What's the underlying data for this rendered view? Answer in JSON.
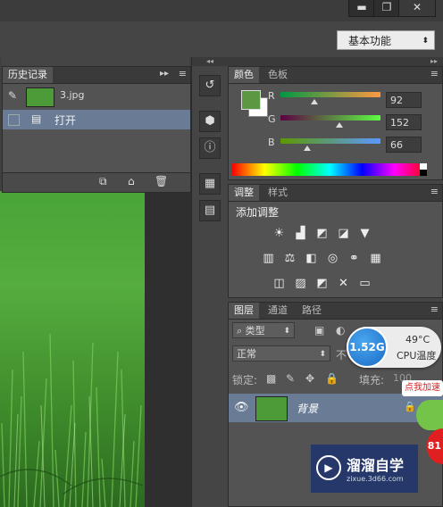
{
  "window": {
    "minimize": "▬",
    "restore": "❐",
    "close": "✕"
  },
  "workspace": {
    "label": "基本功能",
    "arrow": "⬍"
  },
  "history": {
    "tab": "历史记录",
    "snapshot": {
      "name": "3.jpg"
    },
    "items": [
      {
        "label": "打开"
      }
    ]
  },
  "color": {
    "tabs": [
      "颜色",
      "色板"
    ],
    "r_label": "R",
    "g_label": "G",
    "b_label": "B",
    "r": 92,
    "g": 152,
    "b": 66,
    "foreground": "#5c9842",
    "background": "#ffffff"
  },
  "adjustments": {
    "tabs": [
      "调整",
      "样式"
    ],
    "add_label": "添加调整"
  },
  "layers": {
    "tabs": [
      "图层",
      "通道",
      "路径"
    ],
    "filter_kind": "类型",
    "blend_mode": "正常",
    "opacity_label": "不",
    "lock_label": "锁定:",
    "fill_label": "填充:",
    "fill_value": "100",
    "layer_name": "背景"
  },
  "overlay": {
    "speed": "1.52G",
    "temp": "49°C",
    "cpu_label": "CPU温度",
    "promo": "点我加速",
    "badge": "81"
  },
  "watermark": {
    "brand": "溜溜自学",
    "url": "zixue.3d66.com"
  }
}
